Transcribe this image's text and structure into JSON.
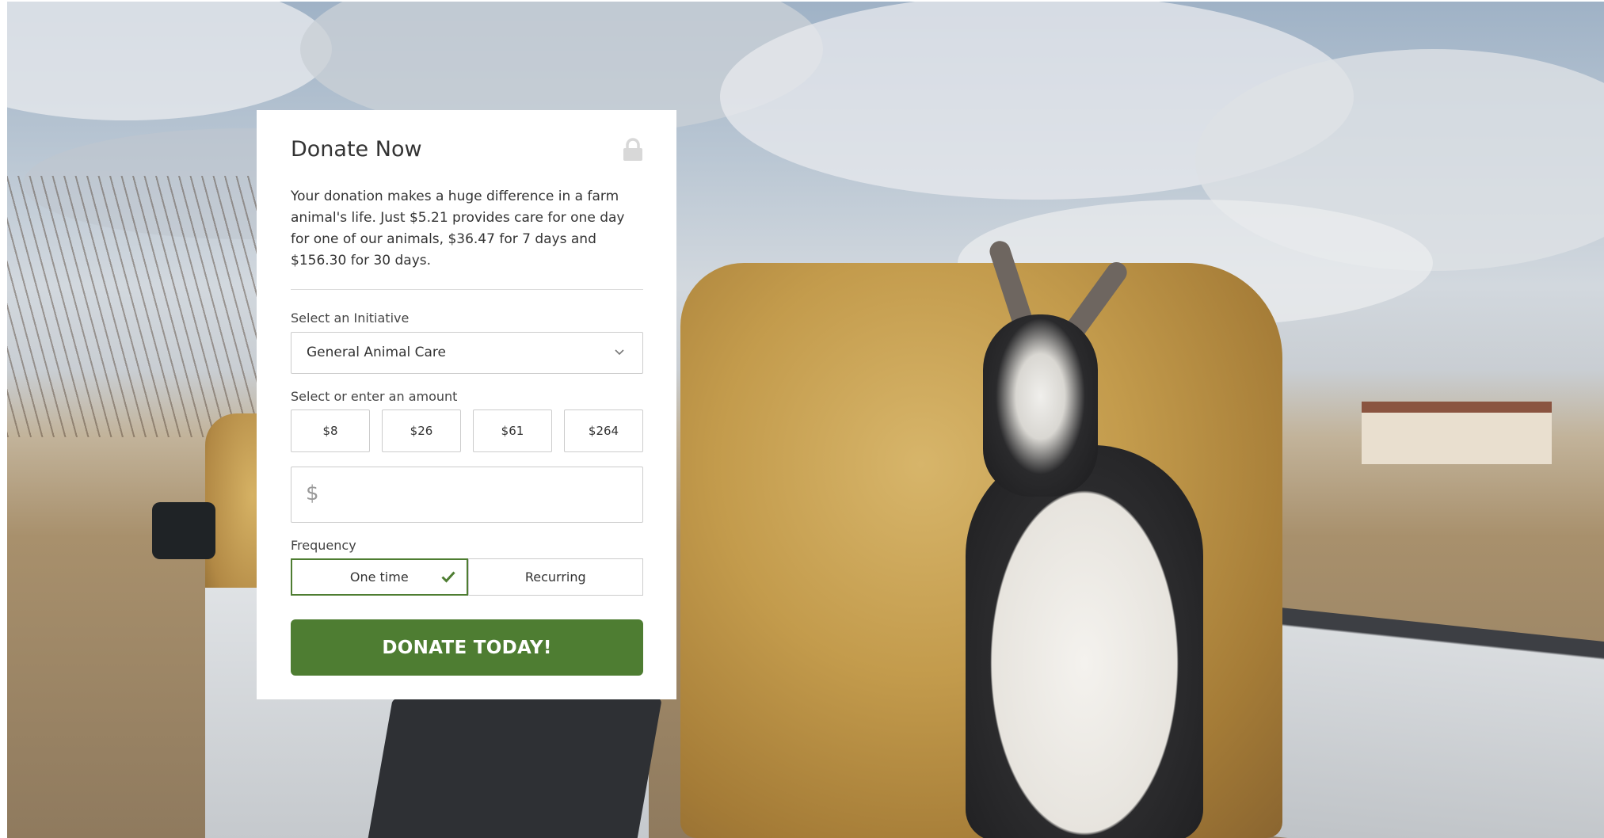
{
  "donation_card": {
    "title": "Donate Now",
    "lock_icon": "lock-icon",
    "description": "Your donation makes a huge difference in a farm animal's life. Just $5.21 provides care for one day for one of our animals, $36.47 for 7 days and $156.30 for 30 days.",
    "initiative": {
      "label": "Select an Initiative",
      "selected": "General Animal Care",
      "icon": "chevron-down-icon"
    },
    "amount": {
      "label": "Select or enter an amount",
      "options": [
        "$8",
        "$26",
        "$61",
        "$264"
      ],
      "currency_symbol": "$",
      "value": ""
    },
    "frequency": {
      "label": "Frequency",
      "options": [
        "One time",
        "Recurring"
      ],
      "selected": "One time",
      "check_icon": "check-icon"
    },
    "donate_button": "DONATE TODAY!",
    "colors": {
      "accent": "#4e7d32",
      "card_background": "#ffffff",
      "text": "#333333"
    }
  }
}
